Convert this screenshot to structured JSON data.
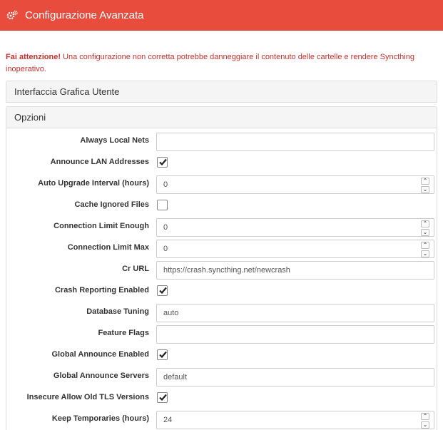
{
  "header": {
    "title": "Configurazione Avanzata",
    "icon": "cogs-icon",
    "color": "#e84c3d"
  },
  "warning": {
    "bold": "Fai attenzione!",
    "text": " Una configurazione non corretta potrebbe danneggiare il contenuto delle cartelle e rendere Syncthing inoperativo."
  },
  "sections": {
    "gui": "Interfaccia Grafica Utente",
    "options": "Opzioni"
  },
  "options": [
    {
      "label": "Always Local Nets",
      "type": "text",
      "value": ""
    },
    {
      "label": "Announce LAN Addresses",
      "type": "checkbox",
      "checked": true
    },
    {
      "label": "Auto Upgrade Interval (hours)",
      "type": "number",
      "value": "0"
    },
    {
      "label": "Cache Ignored Files",
      "type": "checkbox",
      "checked": false
    },
    {
      "label": "Connection Limit Enough",
      "type": "number",
      "value": "0"
    },
    {
      "label": "Connection Limit Max",
      "type": "number",
      "value": "0"
    },
    {
      "label": "Cr URL",
      "type": "text",
      "value": "https://crash.syncthing.net/newcrash"
    },
    {
      "label": "Crash Reporting Enabled",
      "type": "checkbox",
      "checked": true
    },
    {
      "label": "Database Tuning",
      "type": "text",
      "value": "auto"
    },
    {
      "label": "Feature Flags",
      "type": "text",
      "value": ""
    },
    {
      "label": "Global Announce Enabled",
      "type": "checkbox",
      "checked": true
    },
    {
      "label": "Global Announce Servers",
      "type": "text",
      "value": "default"
    },
    {
      "label": "Insecure Allow Old TLS Versions",
      "type": "checkbox",
      "checked": true
    },
    {
      "label": "Keep Temporaries (hours)",
      "type": "number",
      "value": "24"
    }
  ]
}
